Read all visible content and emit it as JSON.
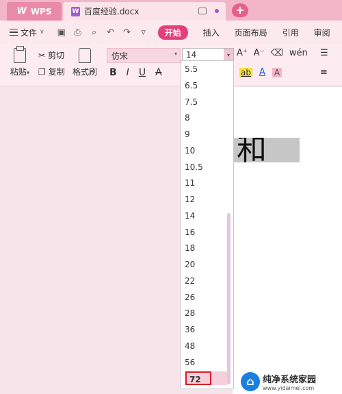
{
  "titlebar": {
    "app_tab": "WPS",
    "doc_tab": "百度经验.docx",
    "doc_icon": "W"
  },
  "menubar": {
    "file": "文件",
    "tabs": [
      "开始",
      "插入",
      "页面布局",
      "引用",
      "审阅"
    ]
  },
  "ribbon": {
    "paste": "粘贴",
    "cut": "剪切",
    "copy": "复制",
    "format_painter": "格式刷",
    "font_name": "仿宋",
    "font_size": "14",
    "bold": "B",
    "italic": "I",
    "underline": "U",
    "strike": "A",
    "grow": "A⁺",
    "shrink": "A⁻",
    "highlight": "ab",
    "font_color": "A",
    "char_shade": "A",
    "pinyin": "wén"
  },
  "document": {
    "selected_text": "和"
  },
  "font_size_dropdown": {
    "items": [
      "5.5",
      "6.5",
      "7.5",
      "8",
      "9",
      "10",
      "10.5",
      "11",
      "12",
      "14",
      "16",
      "18",
      "20",
      "22",
      "26",
      "28",
      "36",
      "48",
      "56",
      "72"
    ],
    "highlighted": "72"
  },
  "watermark": {
    "title": "纯净系统家园",
    "url": "www.yidaimei.com"
  },
  "colors": {
    "accent": "#e3407a",
    "title_bar": "#f3b6c9",
    "selection_box": "#d81e2a"
  }
}
